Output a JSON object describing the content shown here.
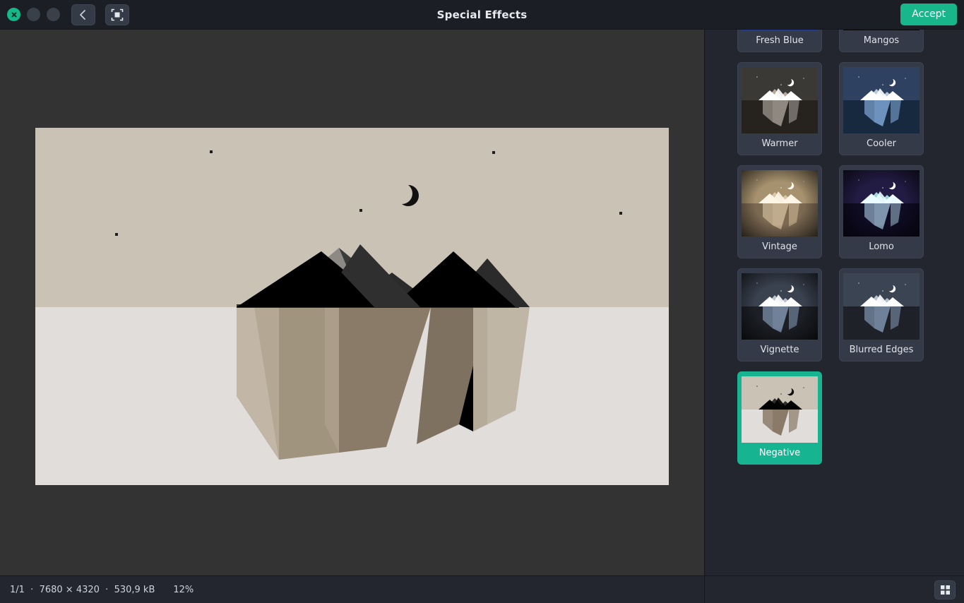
{
  "window": {
    "title": "Special Effects",
    "close_icon": "close-icon",
    "minimize_icon": "minimize-icon",
    "maximize_icon": "maximize-icon",
    "back_icon": "chevron-left-icon",
    "fit_icon": "fit-to-screen-icon",
    "accept_label": "Accept",
    "accent_color": "#18b68b"
  },
  "statusbar": {
    "meta": "1/1  ·  7680 × 4320  ·  530,9 kB",
    "zoom": "12%",
    "grid_icon": "grid-view-icon"
  },
  "image": {
    "sky_color": "#cbc2b6",
    "water_color": "#e1dddb",
    "moon_color": "#111111",
    "peaks_color": "#000000",
    "reflection_color": "#8a7b68"
  },
  "effects": {
    "selected": "Negative",
    "items": [
      {
        "label": "Fresh Blue",
        "selected": false,
        "sky": "#1c2f6e",
        "water": "#26408f",
        "ice": "#dfe9f7",
        "ice2": "#5b7fd0",
        "refl": "#3c5fb5",
        "moon": "#ffffff",
        "vignette": false
      },
      {
        "label": "Mangos",
        "selected": false,
        "sky": "#1e2127",
        "water": "#14161a",
        "ice": "#f2ede4",
        "ice2": "#8d939d",
        "refl": "#6c737e",
        "moon": "#f7e9c8",
        "vignette": true
      },
      {
        "label": "Warmer",
        "selected": false,
        "sky": "#3b3936",
        "water": "#26231f",
        "ice": "#ffffff",
        "ice2": "#b3a99c",
        "refl": "#8e8880",
        "moon": "#ffffff",
        "vignette": false
      },
      {
        "label": "Cooler",
        "selected": false,
        "sky": "#2f4160",
        "water": "#16293f",
        "ice": "#ffffff",
        "ice2": "#b9c9dc",
        "refl": "#6d92bd",
        "moon": "#ffffff",
        "vignette": false
      },
      {
        "label": "Vintage",
        "selected": false,
        "sky": "#a7926f",
        "water": "#7b6952",
        "ice": "#fdf6e7",
        "ice2": "#d9c6a6",
        "refl": "#c0ab8c",
        "moon": "#fffaf0",
        "vignette": true
      },
      {
        "label": "Lomo",
        "selected": false,
        "sky": "#221c44",
        "water": "#0e0b22",
        "ice": "#eafcff",
        "ice2": "#9fd6d8",
        "refl": "#7f95ad",
        "moon": "#ffffff",
        "vignette": true
      },
      {
        "label": "Vignette",
        "selected": false,
        "sky": "#3a4250",
        "water": "#1c1f25",
        "ice": "#ffffff",
        "ice2": "#b8c2cf",
        "refl": "#708199",
        "moon": "#ffffff",
        "vignette": true
      },
      {
        "label": "Blurred Edges",
        "selected": false,
        "sky": "#3b4452",
        "water": "#1e2127",
        "ice": "#ffffff",
        "ice2": "#b6c1ce",
        "refl": "#6f8099",
        "moon": "#ffffff",
        "vignette": false
      },
      {
        "label": "Negative",
        "selected": true,
        "sky": "#cbc2b6",
        "water": "#e1dddb",
        "ice": "#000000",
        "ice2": "#2e2e2e",
        "refl": "#8a7b68",
        "moon": "#111111",
        "vignette": false
      }
    ]
  }
}
